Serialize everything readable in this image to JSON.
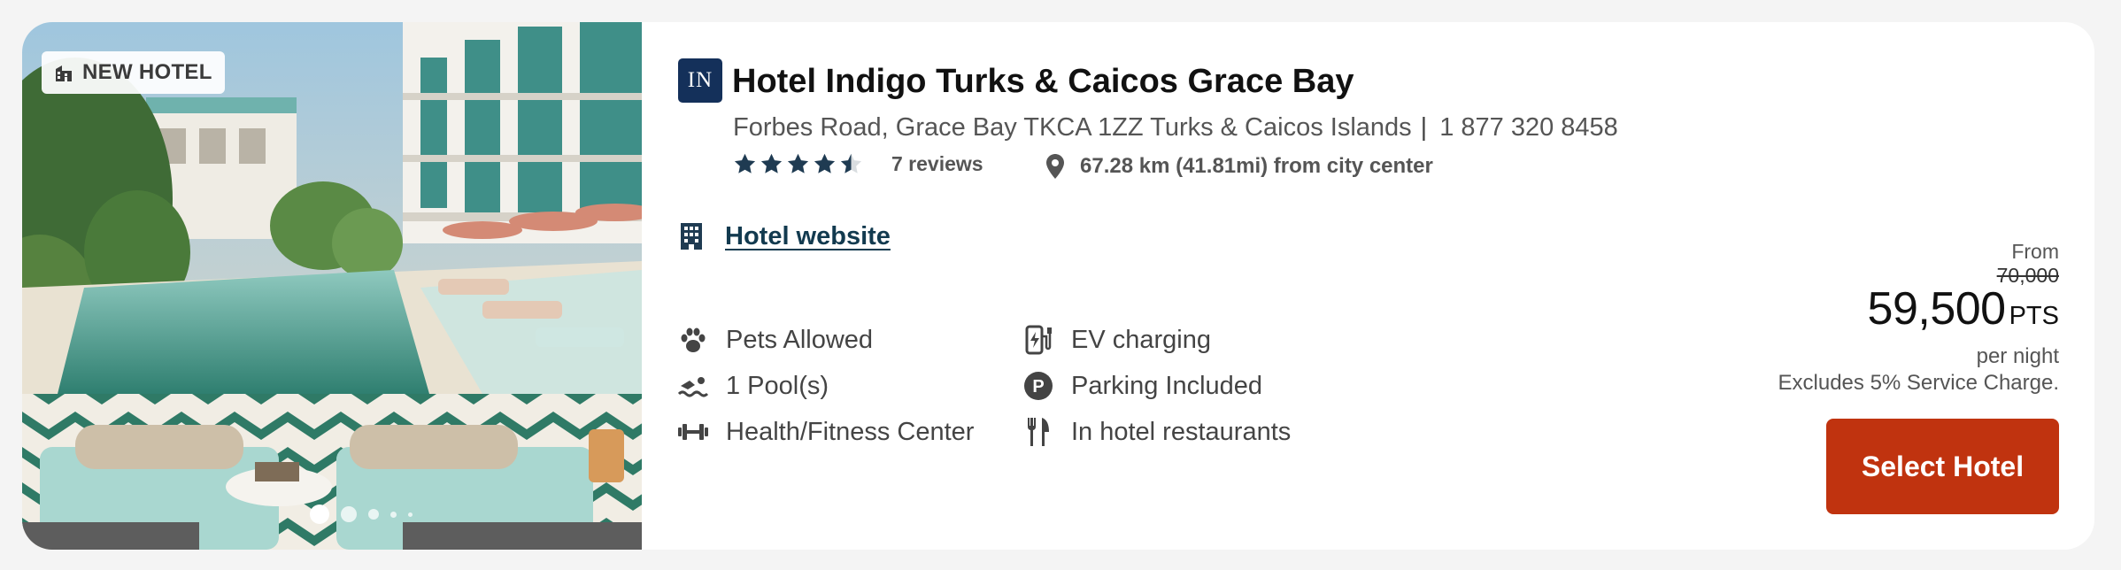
{
  "badge": {
    "label": "NEW HOTEL",
    "icon": "building-icon"
  },
  "carousel": {
    "dots": 5,
    "active_index": 0
  },
  "hotel": {
    "logo_text": "IN",
    "name": "Hotel Indigo Turks & Caicos Grace Bay",
    "address": "Forbes Road, Grace Bay TKCA 1ZZ Turks & Caicos Islands",
    "separator": "|",
    "phone": "1 877 320 8458",
    "rating": 4.5,
    "rating_max": 5,
    "reviews": "7 reviews",
    "distance": "67.28 km (41.81mi) from city center",
    "website_label": "Hotel website"
  },
  "amenities": [
    {
      "icon": "paw-icon",
      "label": "Pets Allowed"
    },
    {
      "icon": "ev-charging-icon",
      "label": "EV charging"
    },
    {
      "icon": "swimmer-icon",
      "label": "1 Pool(s)"
    },
    {
      "icon": "parking-icon",
      "label": "Parking Included"
    },
    {
      "icon": "dumbbell-icon",
      "label": "Health/Fitness Center"
    },
    {
      "icon": "utensils-icon",
      "label": "In hotel restaurants"
    }
  ],
  "pricing": {
    "from_label": "From",
    "original": "70,000",
    "price": "59,500",
    "unit": "PTS",
    "per_night": "per night",
    "note": "Excludes 5% Service Charge.",
    "button_label": "Select Hotel"
  },
  "colors": {
    "brand_navy": "#14305a",
    "star": "#1f3b52",
    "button": "#c0330f",
    "link": "#123a4f"
  }
}
